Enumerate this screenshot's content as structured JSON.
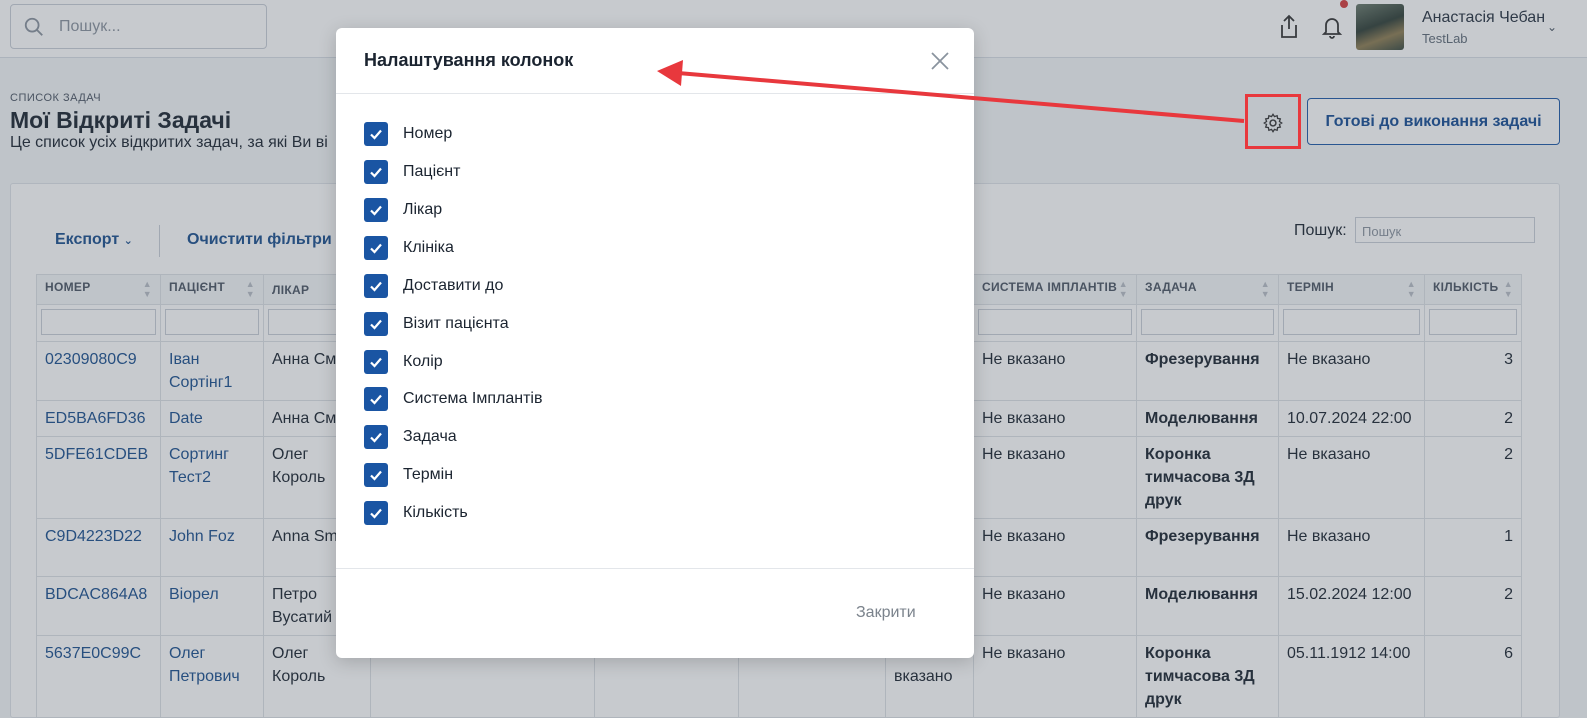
{
  "topbar": {
    "search_placeholder": "Пошук...",
    "user_name": "Анастасія Чебан",
    "user_org": "TestLab"
  },
  "header": {
    "eyebrow": "Список задач",
    "title": "Мої Відкриті Задачі",
    "subtitle": "Це список усіх відкритих задач, за які Ви ві",
    "ready_button": "Готові до виконання задачі"
  },
  "toolbar": {
    "export": "Експорт",
    "clear_filters": "Очистити фільтри",
    "search_label": "Пошук:",
    "search_placeholder": "Пошук"
  },
  "table": {
    "columns": [
      "НОМЕР",
      "ПАЦІЄНТ",
      "ЛІКАР",
      "",
      "",
      "",
      "",
      "СИСТЕМА ІМПЛАНТІВ",
      "ЗАДАЧА",
      "ТЕРМІН",
      "КІЛЬКІСТЬ"
    ],
    "rows": [
      {
        "id": "02309080C9",
        "patient": "Іван Сортінг1",
        "doctor": "Анна См",
        "c7": "",
        "implant": "Не вказано",
        "task": "Фрезерування",
        "term": "Не вказано",
        "qty": "3"
      },
      {
        "id": "ED5BA6FD36",
        "patient": "Date",
        "doctor": "Анна См",
        "c7": "",
        "implant": "Не вказано",
        "task": "Моделювання",
        "term": "10.07.2024 22:00",
        "qty": "2"
      },
      {
        "id": "5DFE61CDEB",
        "patient": "Сортинг Тест2",
        "doctor": "Олег Король",
        "c7": "",
        "implant": "Не вказано",
        "task": "Коронка тимчасова 3Д друк",
        "term": "Не вказано",
        "qty": "2"
      },
      {
        "id": "C9D4223D22",
        "patient": "John Foz",
        "doctor": "Anna Smith",
        "c7": "",
        "implant": "Не вказано",
        "task": "Фрезерування",
        "term": "Не вказано",
        "qty": "1"
      },
      {
        "id": "BDCAC864A8",
        "patient": "Віорел",
        "doctor": "Петро Вусатий",
        "c7": "",
        "implant": "Не вказано",
        "task": "Моделювання",
        "term": "15.02.2024 12:00",
        "qty": "2"
      },
      {
        "id": "5637E0C99C",
        "patient": "Олег Петрович",
        "doctor": "Олег Король",
        "c7": "вказано",
        "implant": "Не вказано",
        "task": "Коронка тимчасова 3Д друк",
        "term": "05.11.1912 14:00",
        "qty": "6"
      }
    ]
  },
  "modal": {
    "title": "Налаштування колонок",
    "options": [
      "Номер",
      "Пацієнт",
      "Лікар",
      "Клініка",
      "Доставити до",
      "Візит пацієнта",
      "Колір",
      "Система Імплантів",
      "Задача",
      "Термін",
      "Кількість"
    ],
    "close_button": "Закрити"
  },
  "colors": {
    "accent": "#1a55a3",
    "link": "#1b4f8f",
    "annotation": "#e8383d"
  }
}
